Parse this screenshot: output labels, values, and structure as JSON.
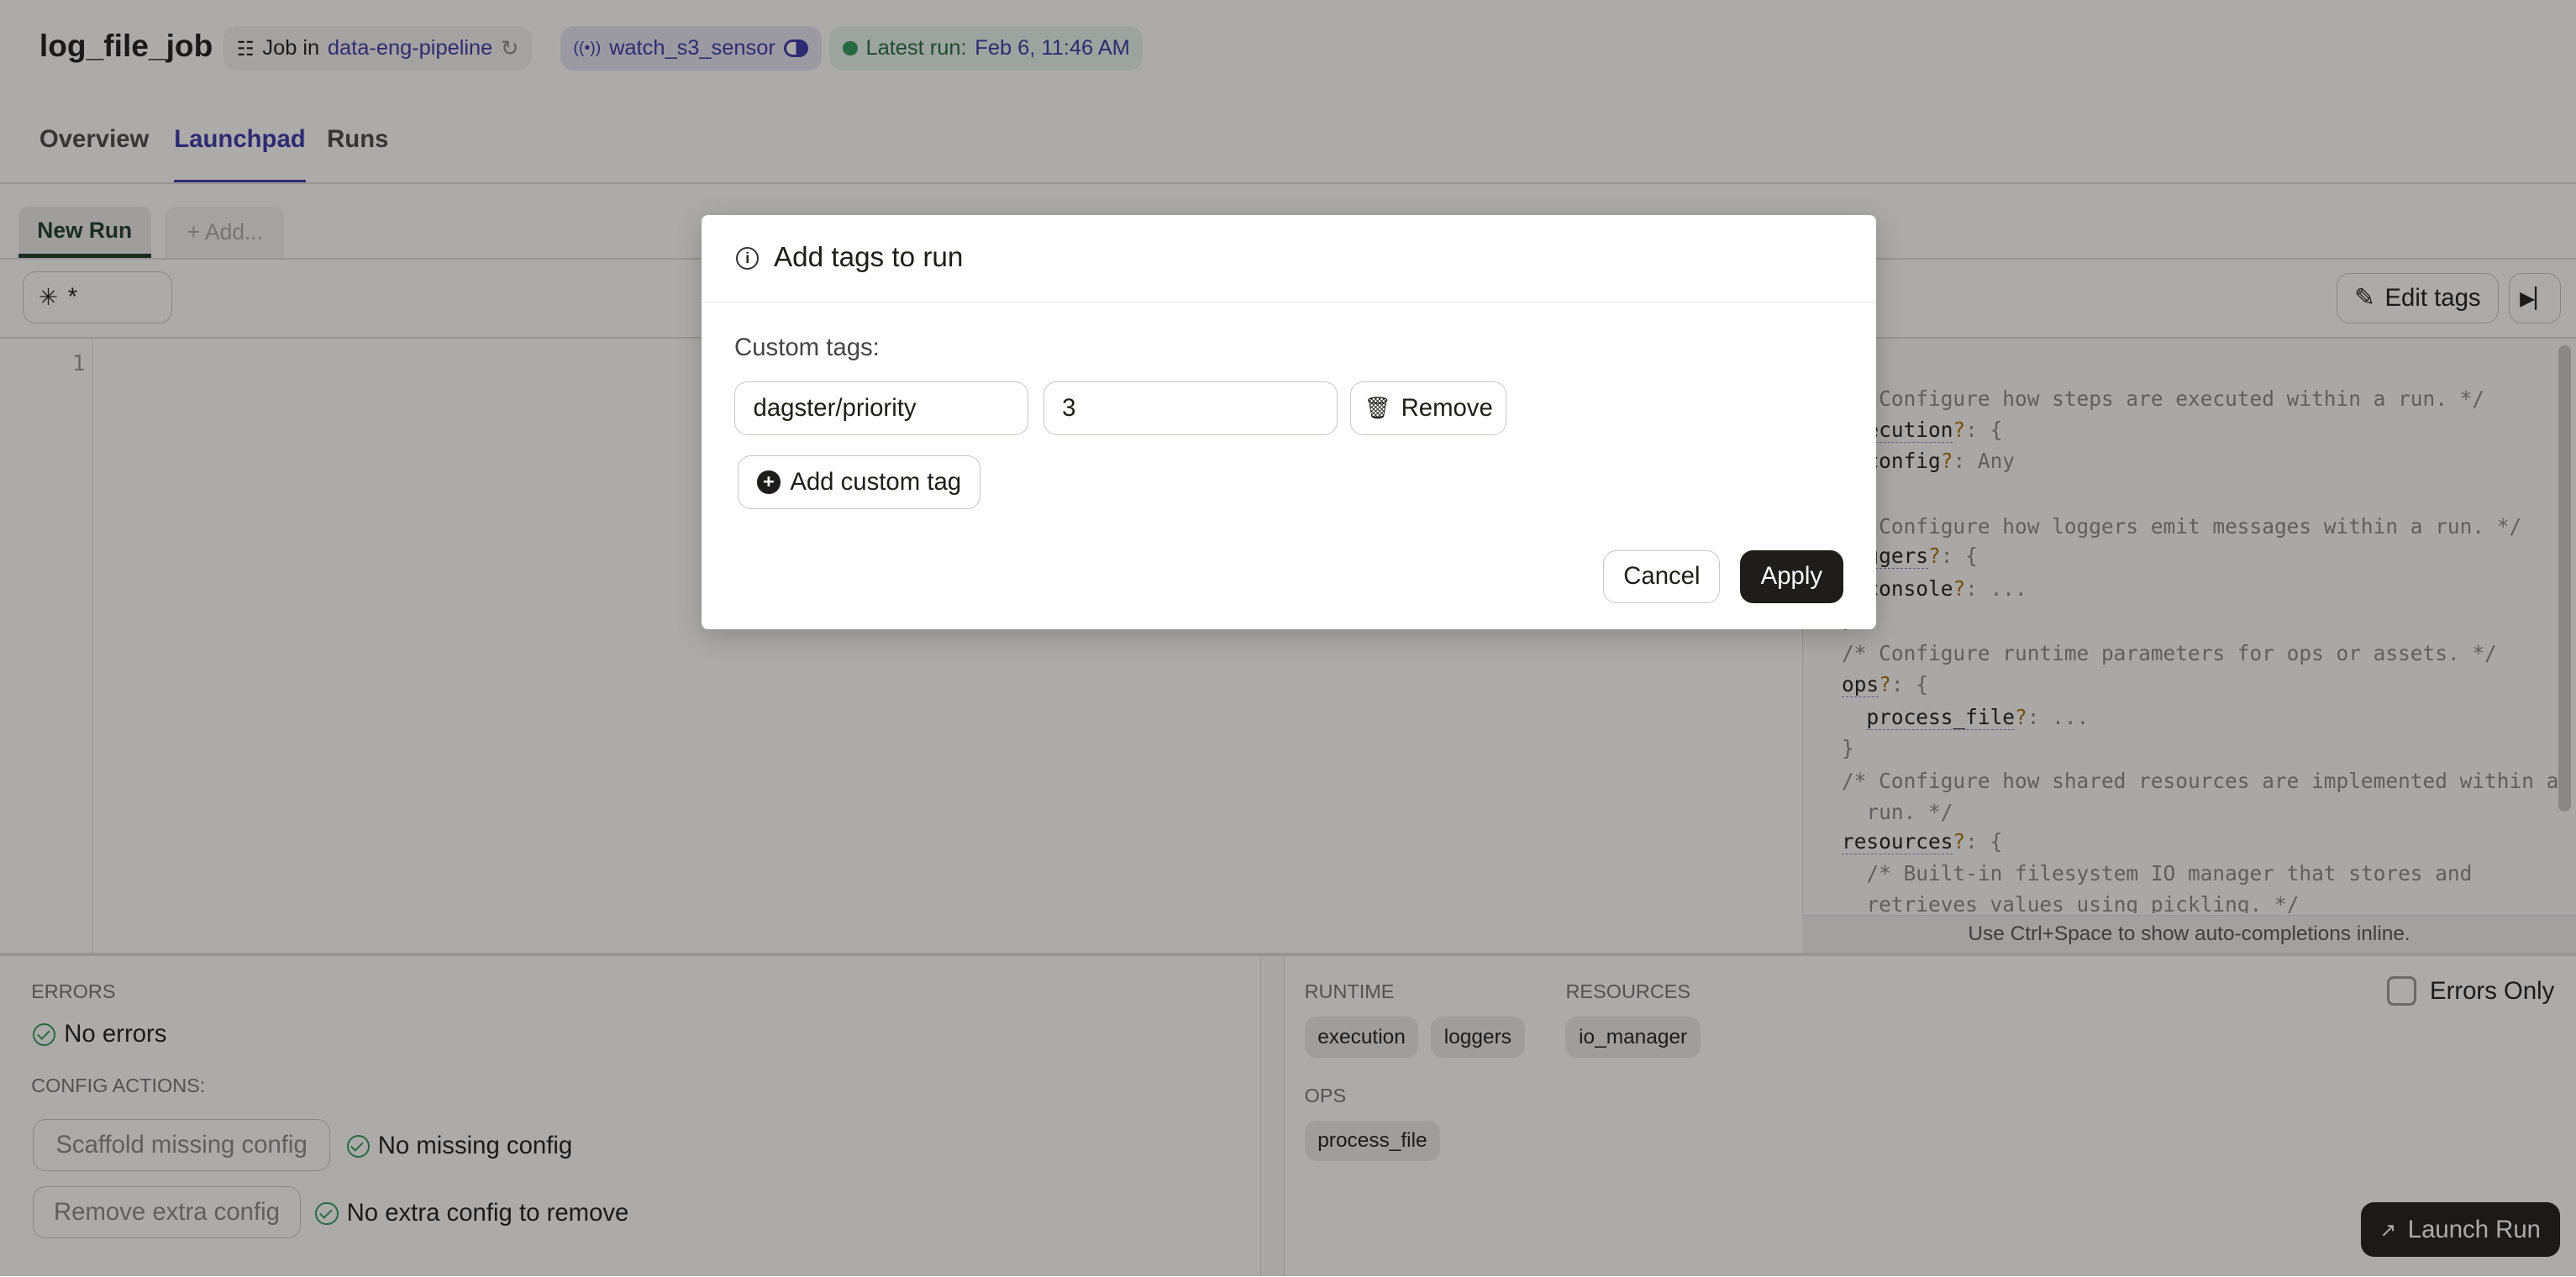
{
  "header": {
    "title": "log_file_job",
    "job_prefix": "Job in",
    "job_location": "data-eng-pipeline",
    "sensor_name": "watch_s3_sensor",
    "latest_run_label": "Latest run:",
    "latest_run_time": "Feb 6, 11:46 AM"
  },
  "tabs": [
    {
      "label": "Overview"
    },
    {
      "label": "Launchpad",
      "active": true
    },
    {
      "label": "Runs"
    }
  ],
  "session_tabs": {
    "new_run": "New Run",
    "add": "+ Add..."
  },
  "toolbar": {
    "selector_value": "*",
    "edit_tags": "Edit tags"
  },
  "editor": {
    "line_number": "1",
    "hint": "Use Ctrl+Space to show auto-completions inline."
  },
  "config_schema": {
    "lines": [
      "/* Configure how steps are executed within a run. */",
      "execution",
      "config",
      "Any",
      "/* Configure how loggers emit messages within a run. */",
      "loggers",
      "console",
      "/* Configure runtime parameters for ops or assets. */",
      "ops",
      "process_file",
      "/* Configure how shared resources are implemented within a",
      "run. */",
      "resources",
      "/* Built-in filesystem IO manager that stores and",
      "retrieves values using pickling. */"
    ]
  },
  "bottom": {
    "errors_label": "ERRORS",
    "no_errors": "No errors",
    "config_actions_label": "CONFIG ACTIONS:",
    "scaffold_button": "Scaffold missing config",
    "no_missing": "No missing config",
    "remove_button": "Remove extra config",
    "no_extra": "No extra config to remove",
    "runtime_label": "RUNTIME",
    "runtime_items": [
      "execution",
      "loggers"
    ],
    "resources_label": "RESOURCES",
    "resources_items": [
      "io_manager"
    ],
    "ops_label": "OPS",
    "ops_items": [
      "process_file"
    ],
    "errors_only": "Errors Only",
    "errors_only_checked": false,
    "launch_run": "Launch Run"
  },
  "modal": {
    "title": "Add tags to run",
    "custom_tags_label": "Custom tags:",
    "tags": [
      {
        "key": "dagster/priority",
        "value": "3"
      }
    ],
    "remove": "Remove",
    "add_custom_tag": "Add custom tag",
    "cancel": "Cancel",
    "apply": "Apply"
  },
  "colors": {
    "accent": "#3b37a8",
    "success": "#2f9a5b",
    "primary_button": "#1f1d1a"
  }
}
